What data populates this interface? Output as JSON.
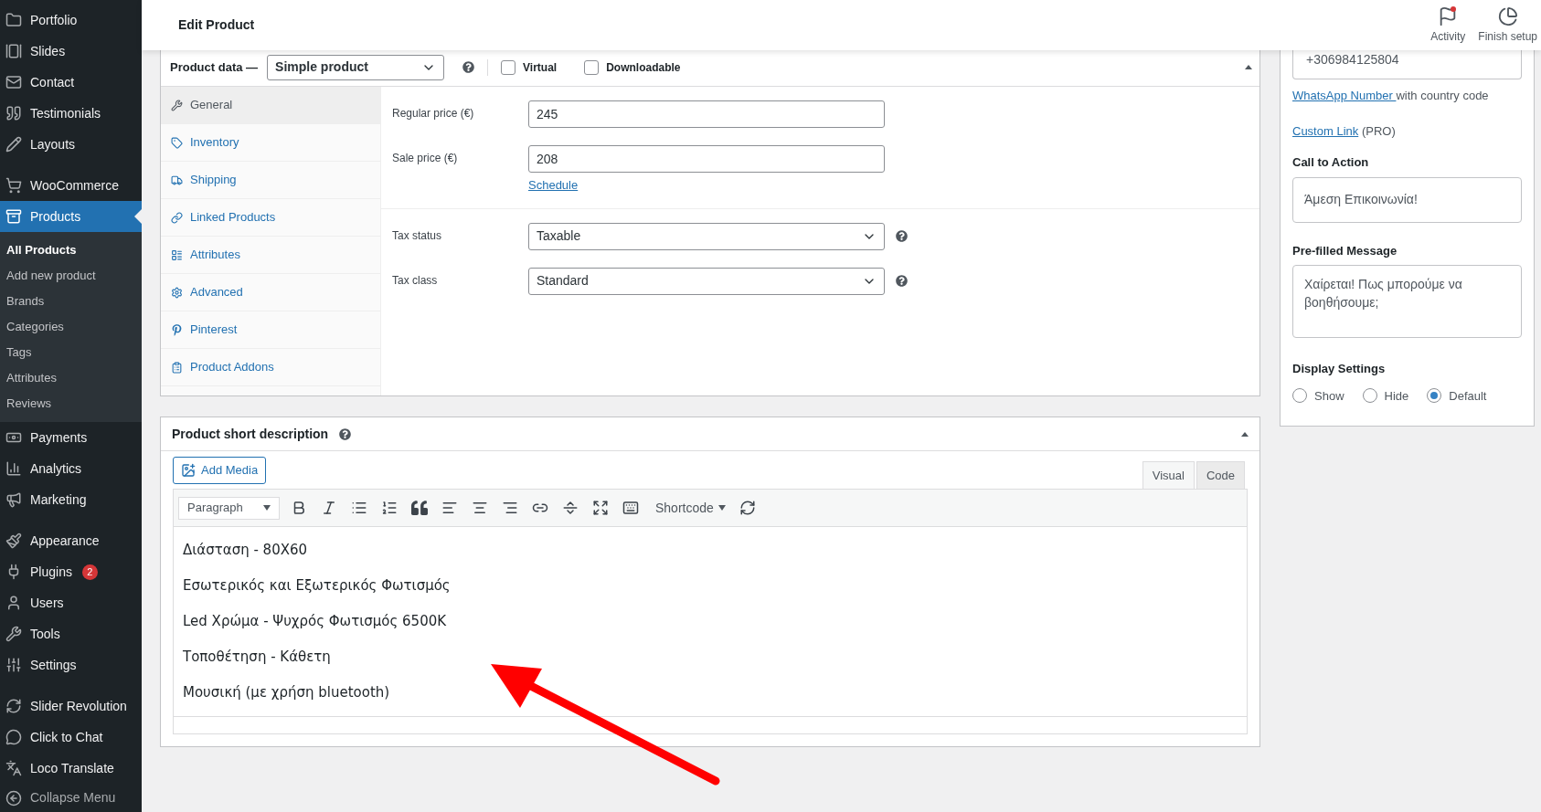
{
  "sidebar": {
    "groups": [
      [
        {
          "label": "Portfolio",
          "selected": false
        },
        {
          "label": "Slides",
          "selected": false
        },
        {
          "label": "Contact",
          "selected": false
        },
        {
          "label": "Testimonials",
          "selected": false
        },
        {
          "label": "Layouts",
          "selected": false
        }
      ],
      [
        {
          "label": "WooCommerce",
          "selected": false
        },
        {
          "label": "Products",
          "selected": true,
          "children": [
            {
              "label": "All Products",
              "selected": true
            },
            {
              "label": "Add new product",
              "selected": false
            },
            {
              "label": "Brands",
              "selected": false
            },
            {
              "label": "Categories",
              "selected": false
            },
            {
              "label": "Tags",
              "selected": false
            },
            {
              "label": "Attributes",
              "selected": false
            },
            {
              "label": "Reviews",
              "selected": false
            }
          ]
        }
      ],
      [
        {
          "label": "Payments",
          "selected": false
        },
        {
          "label": "Analytics",
          "selected": false
        },
        {
          "label": "Marketing",
          "selected": false
        }
      ],
      [
        {
          "label": "Appearance",
          "selected": false
        },
        {
          "label": "Plugins",
          "selected": false,
          "badge": "2"
        },
        {
          "label": "Users",
          "selected": false
        },
        {
          "label": "Tools",
          "selected": false
        },
        {
          "label": "Settings",
          "selected": false
        }
      ],
      [
        {
          "label": "Slider Revolution",
          "selected": false
        },
        {
          "label": "Click to Chat",
          "selected": false
        },
        {
          "label": "Loco Translate",
          "selected": false
        }
      ]
    ],
    "collapse": "Collapse Menu"
  },
  "header": {
    "title": "Edit Product",
    "actions": [
      {
        "label": "Activity",
        "notification": true
      },
      {
        "label": "Finish setup",
        "notification": false
      }
    ]
  },
  "product_data": {
    "title": "Product data —",
    "type": "Simple product",
    "options": [
      {
        "label": "Virtual",
        "checked": false
      },
      {
        "label": "Downloadable",
        "checked": false
      }
    ],
    "tabs": [
      {
        "label": "General",
        "selected": true
      },
      {
        "label": "Inventory",
        "selected": false
      },
      {
        "label": "Shipping",
        "selected": false
      },
      {
        "label": "Linked Products",
        "selected": false
      },
      {
        "label": "Attributes",
        "selected": false
      },
      {
        "label": "Advanced",
        "selected": false
      },
      {
        "label": "Pinterest",
        "selected": false
      },
      {
        "label": "Product Addons",
        "selected": false
      }
    ],
    "field_groups": [
      [
        {
          "kind": "text",
          "label": "Regular price (€)",
          "value": "245"
        },
        {
          "kind": "text",
          "label": "Sale price (€)",
          "value": "208",
          "link": "Schedule"
        }
      ],
      [
        {
          "kind": "select",
          "label": "Tax status",
          "value": "Taxable"
        },
        {
          "kind": "select",
          "label": "Tax class",
          "value": "Standard"
        }
      ]
    ]
  },
  "chat_widget": {
    "phone": "+306984125804",
    "phone_hint_link": "WhatsApp Number ",
    "phone_hint": "with country code",
    "custom_link": "Custom Link",
    "custom_link_note": "(PRO)",
    "call_to_action": {
      "label": "Call to Action",
      "value": "Άμεση Επικοινωνία!"
    },
    "prefilled_message": {
      "label": "Pre-filled Message",
      "value": "Χαίρεται! Πως μπορούμε να βοηθήσουμε;"
    },
    "display_settings": {
      "label": "Display Settings",
      "options": [
        {
          "label": "Show",
          "selected": false
        },
        {
          "label": "Hide",
          "selected": false
        },
        {
          "label": "Default",
          "selected": true
        }
      ]
    }
  },
  "short_description": {
    "title": "Product short description",
    "add_media": "Add Media",
    "tabs": [
      {
        "label": "Visual",
        "selected": true
      },
      {
        "label": "Code",
        "selected": false
      }
    ],
    "format": "Paragraph",
    "shortcode": "Shortcode",
    "paragraphs": [
      "Διάσταση - 80X60",
      "Εσωτερικός και Εξωτερικός Φωτισμός",
      "Led Χρώμα - Ψυχρός Φωτισμός 6500K",
      "Τοποθέτηση - Κάθετη",
      "Μουσική (με χρήση bluetooth)"
    ]
  }
}
